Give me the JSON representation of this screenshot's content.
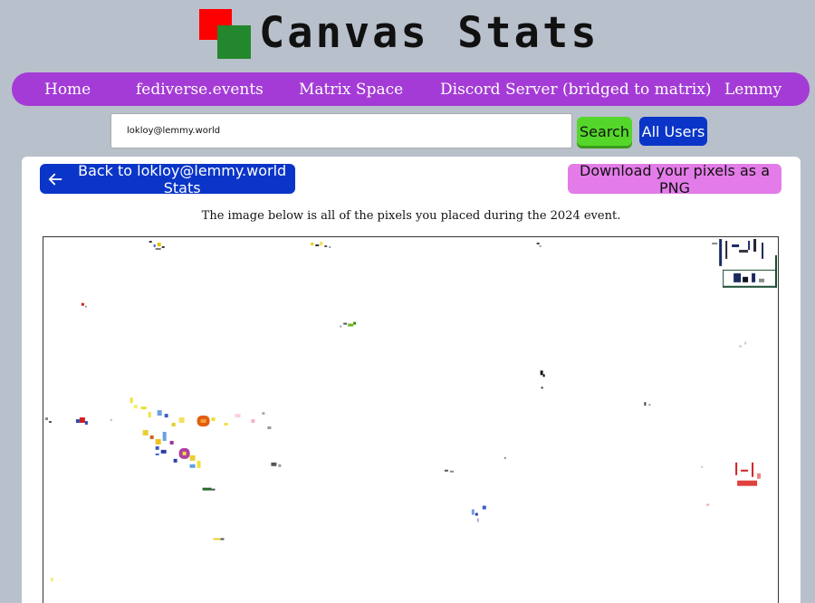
{
  "header": {
    "logo_text": "Canvas Stats"
  },
  "nav": {
    "items": [
      {
        "label": "Home"
      },
      {
        "label": "fediverse.events"
      },
      {
        "label": "Matrix Space"
      },
      {
        "label": "Discord Server (bridged to matrix)"
      },
      {
        "label": "Lemmy"
      }
    ]
  },
  "search": {
    "value": "lokloy@lemmy.world",
    "search_label": "Search",
    "all_users_label": "All Users"
  },
  "main": {
    "back_label": "Back to lokloy@lemmy.world Stats",
    "download_label": "Download your pixels as a PNG",
    "caption": "The image below is all of the pixels you placed during the 2024 event."
  },
  "colors": {
    "background": "#b8c0cb",
    "nav": "#a43bd6",
    "search_button": "#55d62b",
    "primary_button": "#0a35c8",
    "download_button": "#e37ce8",
    "logo_red": "#ff0000",
    "logo_green": "#23882d"
  }
}
